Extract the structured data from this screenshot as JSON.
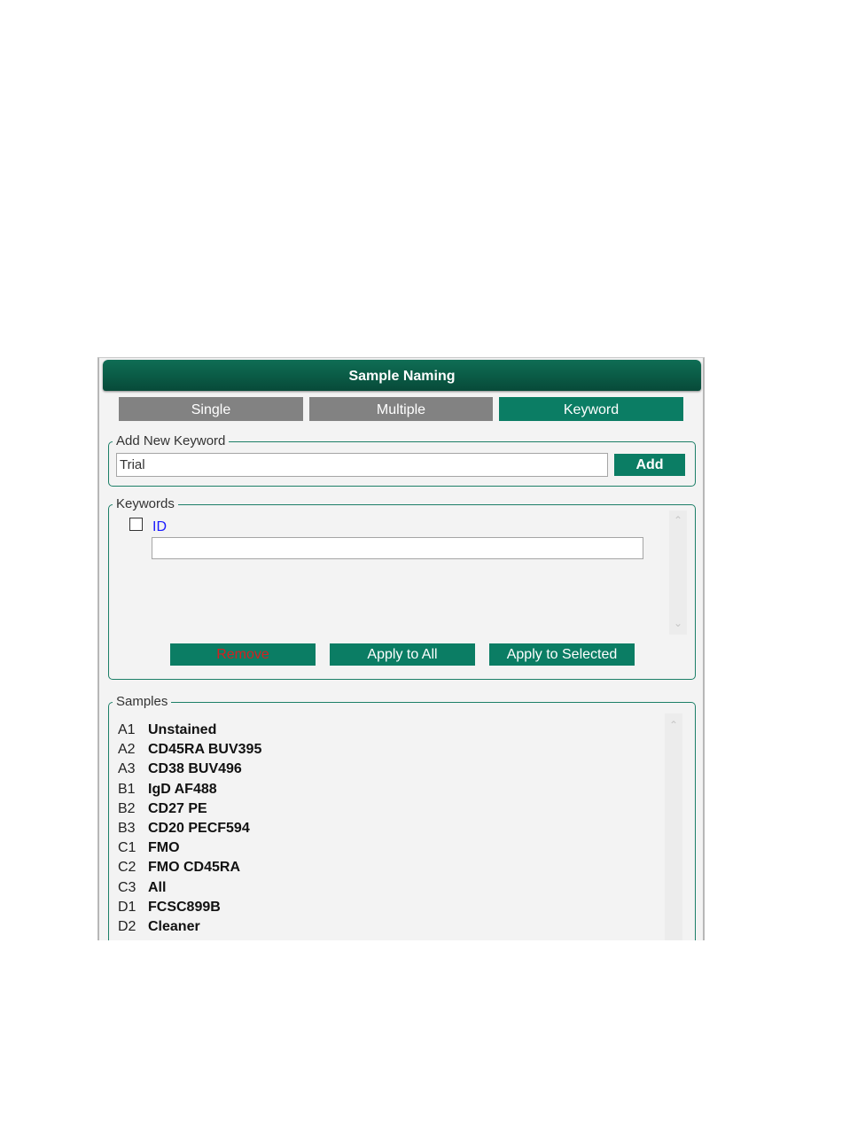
{
  "window": {
    "title": "Sample Naming"
  },
  "tabs": [
    {
      "label": "Single",
      "active": false
    },
    {
      "label": "Multiple",
      "active": false
    },
    {
      "label": "Keyword",
      "active": true
    }
  ],
  "add_keyword": {
    "legend": "Add New Keyword",
    "input_value": "Trial",
    "add_label": "Add"
  },
  "keywords": {
    "legend": "Keywords",
    "items": [
      {
        "label": "ID",
        "checked": false,
        "value": ""
      }
    ],
    "remove_label": "Remove",
    "apply_all_label": "Apply to All",
    "apply_selected_label": "Apply to Selected"
  },
  "samples": {
    "legend": "Samples",
    "items": [
      {
        "well": "A1",
        "name": "Unstained"
      },
      {
        "well": "A2",
        "name": "CD45RA BUV395"
      },
      {
        "well": "A3",
        "name": "CD38 BUV496"
      },
      {
        "well": "B1",
        "name": "IgD AF488"
      },
      {
        "well": "B2",
        "name": "CD27 PE"
      },
      {
        "well": "B3",
        "name": "CD20 PECF594"
      },
      {
        "well": "C1",
        "name": "FMO"
      },
      {
        "well": "C2",
        "name": "FMO CD45RA"
      },
      {
        "well": "C3",
        "name": "All"
      },
      {
        "well": "D1",
        "name": "FCSC899B"
      },
      {
        "well": "D2",
        "name": "Cleaner"
      }
    ]
  },
  "colors": {
    "accent": "#0b7d64",
    "title_bar": "#0a5a45",
    "inactive_tab": "#828282",
    "keyword_label": "#1a1aff",
    "remove_text": "#d42020"
  },
  "icons": {
    "scroll_up": "chevron-up-icon",
    "scroll_down": "chevron-down-icon"
  }
}
